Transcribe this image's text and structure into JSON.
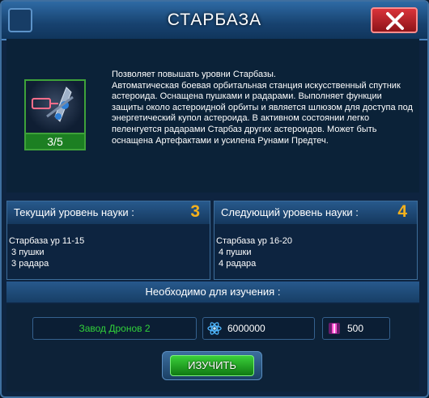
{
  "window": {
    "title": "СТАРБАЗА"
  },
  "item": {
    "level_badge": "3/5",
    "description": "Позволяет повышать уровни Старбазы.\n Автоматическая боевая орбитальная станция искусственный спутник астероида. Оснащена пушками и радарами. Выполняет функции защиты около астероидной орбиты и является шлюзом для доступа под энергетический купол астероида. В активном состоянии легко пеленгуется радарами Старбаз других астероидов. Может быть оснащена Артефактами и усилена Рунами Предтеч."
  },
  "current": {
    "label": "Текущий уровень науки :",
    "level": "3",
    "details": "Старбаза ур 11-15\n 3 пушки\n 3 радара"
  },
  "next": {
    "label": "Следующий уровень науки :",
    "level": "4",
    "details": "Старбаза ур 16-20\n 4 пушки\n 4 радара"
  },
  "requirements": {
    "label": "Необходимо для изучения :",
    "building": "Завод Дронов 2",
    "resource_amount": "6000000",
    "crystal_amount": "500"
  },
  "actions": {
    "study_label": "ИЗУЧИТЬ"
  },
  "icons": {
    "close": "close-x-icon",
    "starbase": "starbase-icon",
    "resource": "atom-icon",
    "crystal": "crystal-icon"
  },
  "colors": {
    "accent": "#f4b01c",
    "green": "#31d13a",
    "title_bar": "#2e6aa4",
    "close": "#d9333a"
  }
}
